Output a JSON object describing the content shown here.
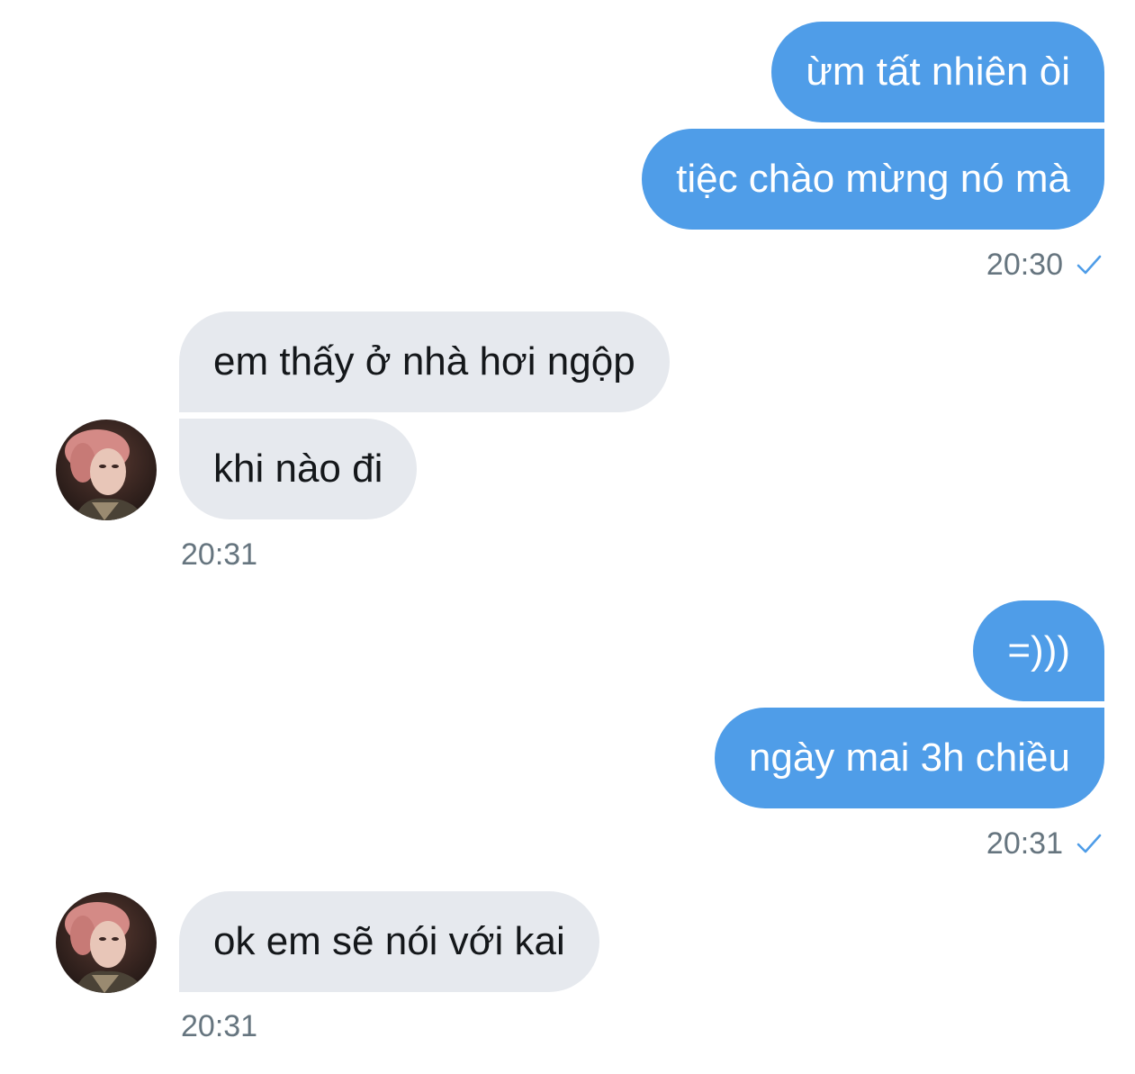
{
  "messages": [
    {
      "text": "ừm tất nhiên òi"
    },
    {
      "text": "tiệc chào mừng nó mà"
    },
    {
      "text": "em thấy ở nhà hơi ngộp"
    },
    {
      "text": "khi nào đi"
    },
    {
      "text": "=)))"
    },
    {
      "text": "ngày mai 3h chiều"
    },
    {
      "text": "ok em sẽ nói với kai"
    }
  ],
  "timestamps": {
    "t1": "20:30",
    "t2": "20:31",
    "t3": "20:31",
    "t4": "20:31"
  },
  "colors": {
    "outgoing_bubble": "#4f9de8",
    "incoming_bubble": "#e6e9ee",
    "timestamp": "#66757f",
    "check": "#4f9de8"
  },
  "icons": {
    "read_receipt": "check-icon",
    "avatar": "avatar"
  }
}
